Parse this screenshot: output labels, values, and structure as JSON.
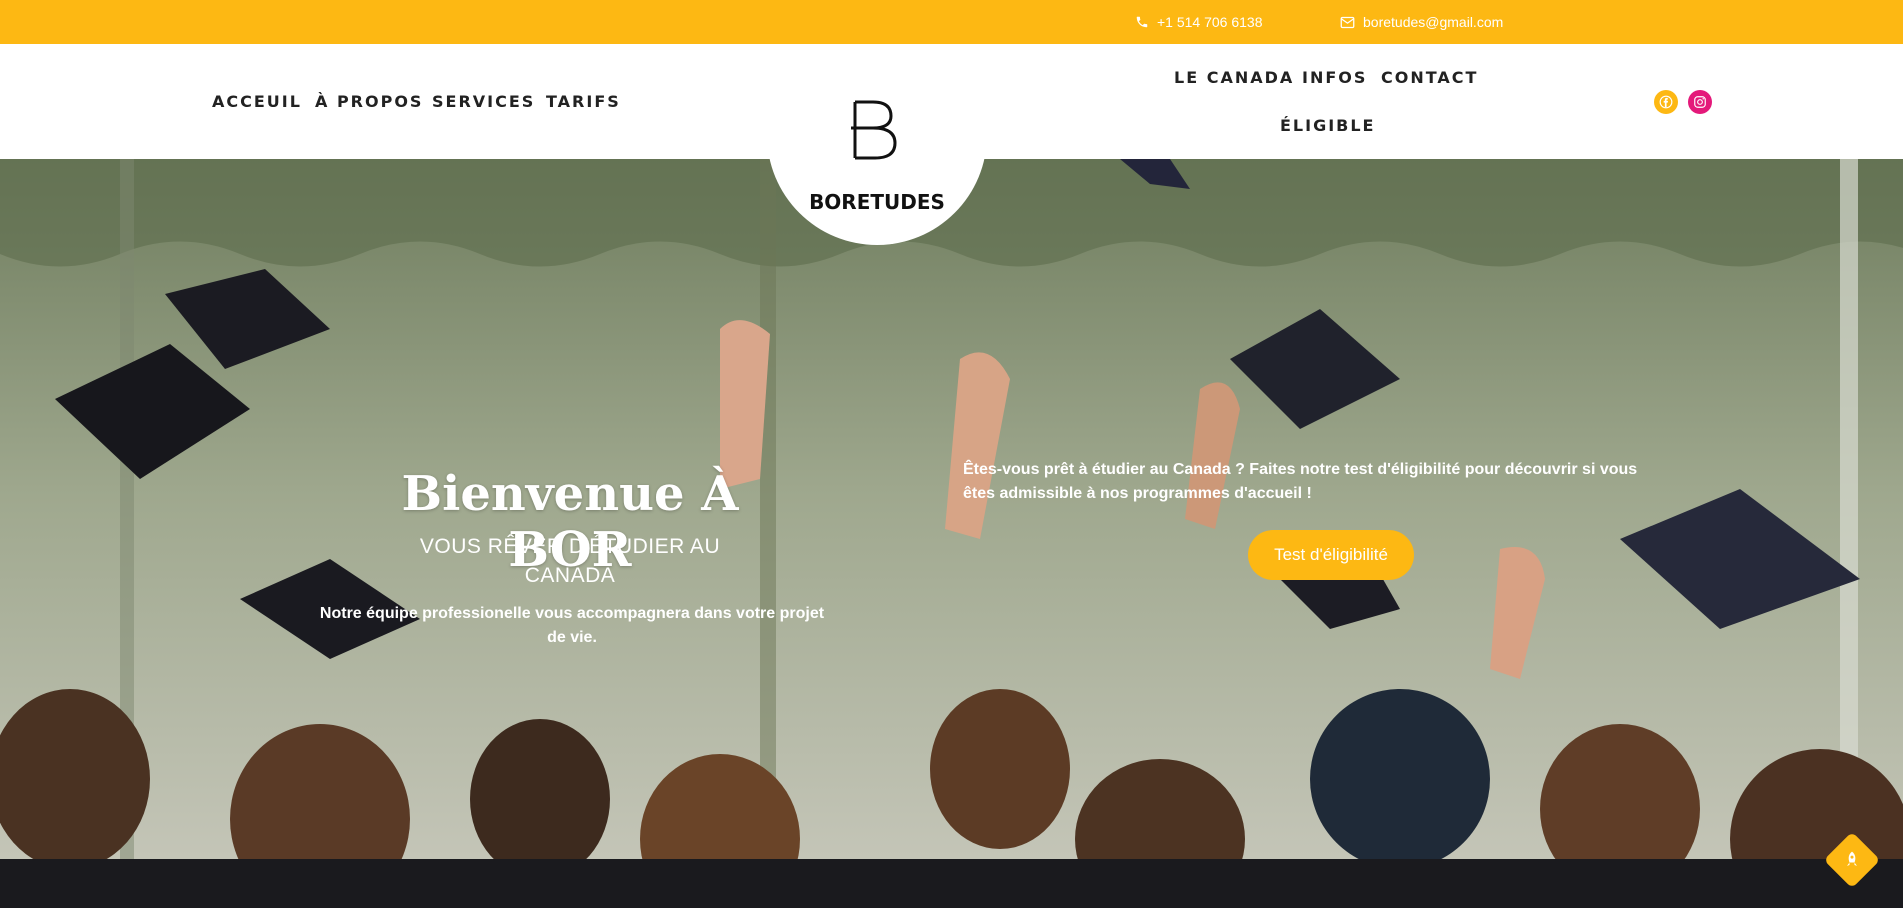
{
  "topbar": {
    "phone": "+1 514 706 6138",
    "email": "boretudes@gmail.com",
    "background": "#FDB813"
  },
  "nav": {
    "left": [
      "ACCEUIL",
      "À PROPOS",
      "SERVICES",
      "TARIFS"
    ],
    "right": [
      "LE CANADA",
      "INFOS",
      "CONTACT",
      "ÉLIGIBLE"
    ]
  },
  "logo": {
    "text": "BORETUDES",
    "icon": "letter-b-logo"
  },
  "social": [
    {
      "name": "facebook-icon",
      "color": "#FDB813"
    },
    {
      "name": "instagram-icon",
      "color": "#E4197A"
    }
  ],
  "hero": {
    "title": "Bienvenue À BOR",
    "subtitle": "VOUS RÊVER D'ÉTUDIER AU CANADA",
    "description": "Notre équipe professionelle vous accompagnera dans votre projet de vie.",
    "right_text": "Êtes-vous prêt à étudier au Canada ? Faites notre test d'éligibilité pour découvrir si vous êtes admissible à nos programmes d'accueil !",
    "cta": "Test d'éligibilité",
    "background_image": "graduates-throwing-caps"
  },
  "scroll_top": {
    "icon": "rocket-icon",
    "color": "#FDB813"
  }
}
